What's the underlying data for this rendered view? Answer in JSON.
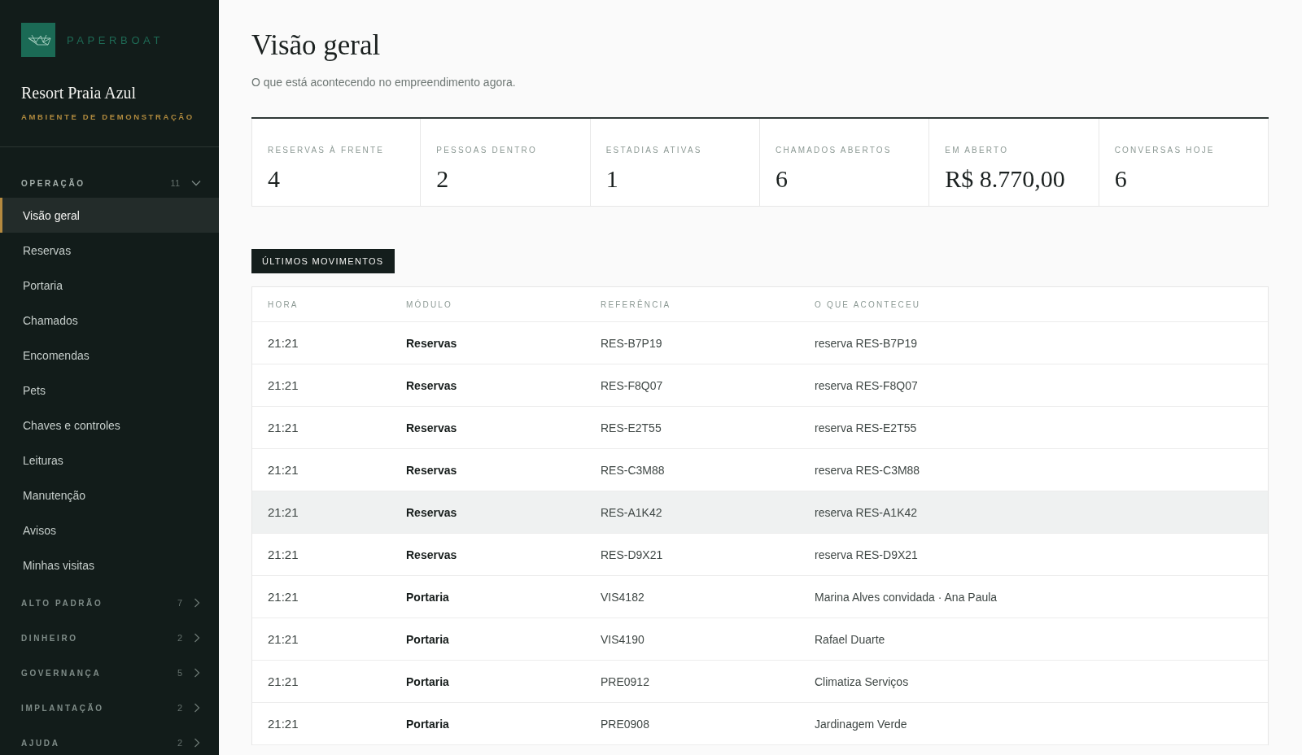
{
  "brand": {
    "name": "PAPERBOAT"
  },
  "property": {
    "name": "Resort Praia Azul",
    "environment": "AMBIENTE DE DEMONSTRAÇÃO"
  },
  "sidebar": {
    "groups": [
      {
        "label": "OPERAÇÃO",
        "count": "11",
        "expanded": true,
        "items": [
          {
            "label": "Visão geral",
            "selected": true
          },
          {
            "label": "Reservas",
            "selected": false
          },
          {
            "label": "Portaria",
            "selected": false
          },
          {
            "label": "Chamados",
            "selected": false
          },
          {
            "label": "Encomendas",
            "selected": false
          },
          {
            "label": "Pets",
            "selected": false
          },
          {
            "label": "Chaves e controles",
            "selected": false
          },
          {
            "label": "Leituras",
            "selected": false
          },
          {
            "label": "Manutenção",
            "selected": false
          },
          {
            "label": "Avisos",
            "selected": false
          },
          {
            "label": "Minhas visitas",
            "selected": false
          }
        ]
      },
      {
        "label": "ALTO PADRÃO",
        "count": "7",
        "expanded": false
      },
      {
        "label": "DINHEIRO",
        "count": "2",
        "expanded": false
      },
      {
        "label": "GOVERNANÇA",
        "count": "5",
        "expanded": false
      },
      {
        "label": "IMPLANTAÇÃO",
        "count": "2",
        "expanded": false
      },
      {
        "label": "AJUDA",
        "count": "2",
        "expanded": false
      }
    ]
  },
  "page": {
    "title": "Visão geral",
    "subtitle": "O que está acontecendo no empreendimento agora."
  },
  "stats": [
    {
      "label": "RESERVAS À FRENTE",
      "value": "4"
    },
    {
      "label": "PESSOAS DENTRO",
      "value": "2"
    },
    {
      "label": "ESTADIAS ATIVAS",
      "value": "1"
    },
    {
      "label": "CHAMADOS ABERTOS",
      "value": "6"
    },
    {
      "label": "EM ABERTO",
      "value": "R$ 8.770,00"
    },
    {
      "label": "CONVERSAS HOJE",
      "value": "6"
    }
  ],
  "section": {
    "label": "ÚLTIMOS MOVIMENTOS"
  },
  "table": {
    "columns": [
      "HORA",
      "MÓDULO",
      "REFERÊNCIA",
      "O QUE ACONTECEU"
    ],
    "rows": [
      {
        "cells": [
          "21:21",
          "Reservas",
          "RES-B7P19",
          "reserva RES-B7P19"
        ],
        "highlighted": false
      },
      {
        "cells": [
          "21:21",
          "Reservas",
          "RES-F8Q07",
          "reserva RES-F8Q07"
        ],
        "highlighted": false
      },
      {
        "cells": [
          "21:21",
          "Reservas",
          "RES-E2T55",
          "reserva RES-E2T55"
        ],
        "highlighted": false
      },
      {
        "cells": [
          "21:21",
          "Reservas",
          "RES-C3M88",
          "reserva RES-C3M88"
        ],
        "highlighted": false
      },
      {
        "cells": [
          "21:21",
          "Reservas",
          "RES-A1K42",
          "reserva RES-A1K42"
        ],
        "highlighted": true
      },
      {
        "cells": [
          "21:21",
          "Reservas",
          "RES-D9X21",
          "reserva RES-D9X21"
        ],
        "highlighted": false
      },
      {
        "cells": [
          "21:21",
          "Portaria",
          "VIS4182",
          "Marina Alves convidada · Ana Paula"
        ],
        "highlighted": false
      },
      {
        "cells": [
          "21:21",
          "Portaria",
          "VIS4190",
          "Rafael Duarte"
        ],
        "highlighted": false
      },
      {
        "cells": [
          "21:21",
          "Portaria",
          "PRE0912",
          "Climatiza Serviços"
        ],
        "highlighted": false
      },
      {
        "cells": [
          "21:21",
          "Portaria",
          "PRE0908",
          "Jardinagem Verde"
        ],
        "highlighted": false
      }
    ]
  }
}
